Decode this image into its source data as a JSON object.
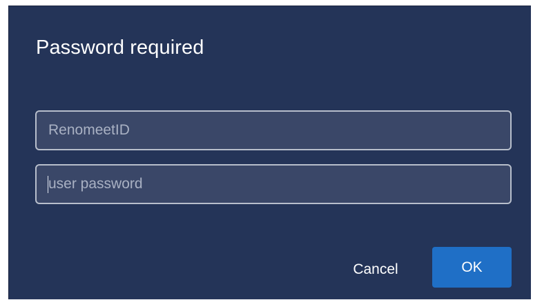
{
  "dialog": {
    "title": "Password required",
    "username_field": {
      "placeholder": "RenomeetID",
      "value": ""
    },
    "password_field": {
      "placeholder": "user password",
      "value": ""
    },
    "cancel_label": "Cancel",
    "ok_label": "OK"
  },
  "colors": {
    "dialog_background": "#243458",
    "field_background": "#3a4768",
    "field_border": "#b8bfcc",
    "ok_button": "#1f6fc6",
    "text": "#ffffff",
    "placeholder": "#a9b1c3"
  }
}
